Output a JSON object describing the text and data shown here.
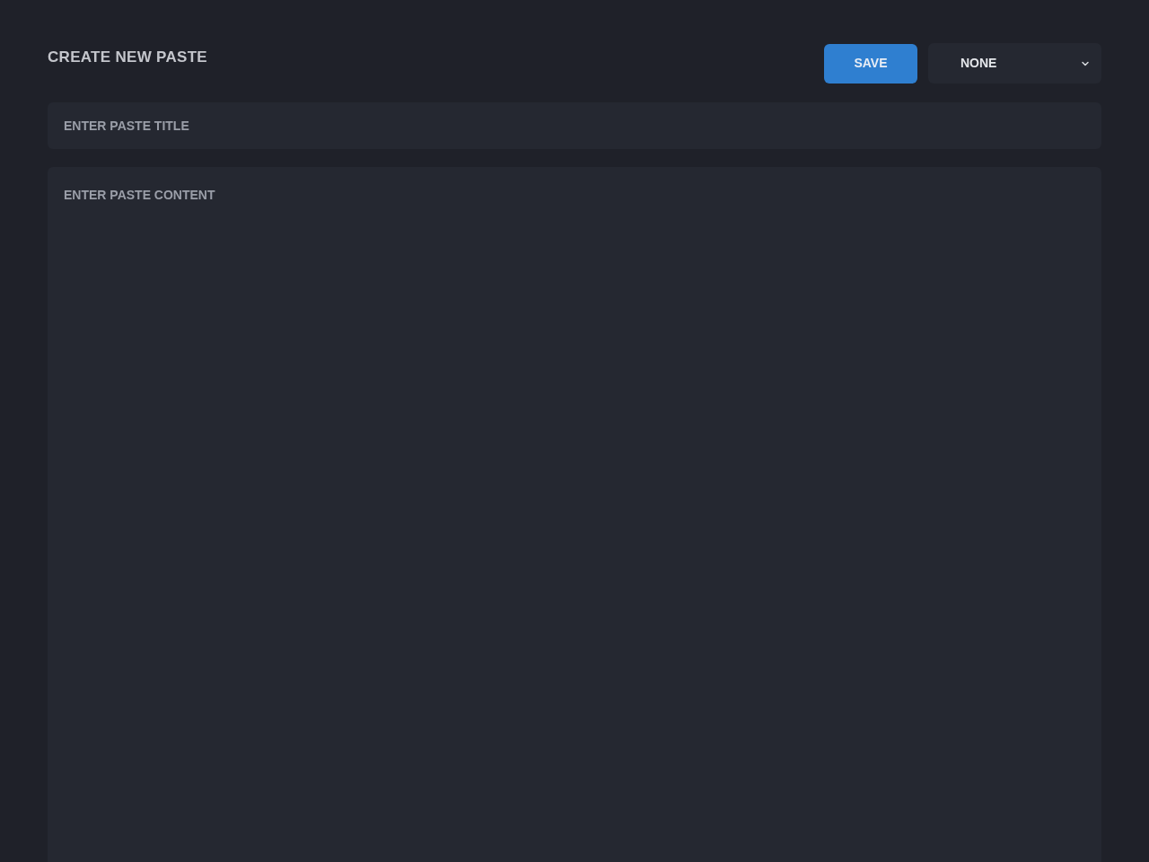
{
  "heading": "CREATE NEW PASTE",
  "save_button": {
    "label": "SAVE"
  },
  "syntax_select": {
    "value": "NONE"
  },
  "title_field": {
    "placeholder": "ENTER PASTE TITLE"
  },
  "content_field": {
    "placeholder": "ENTER PASTE CONTENT"
  }
}
